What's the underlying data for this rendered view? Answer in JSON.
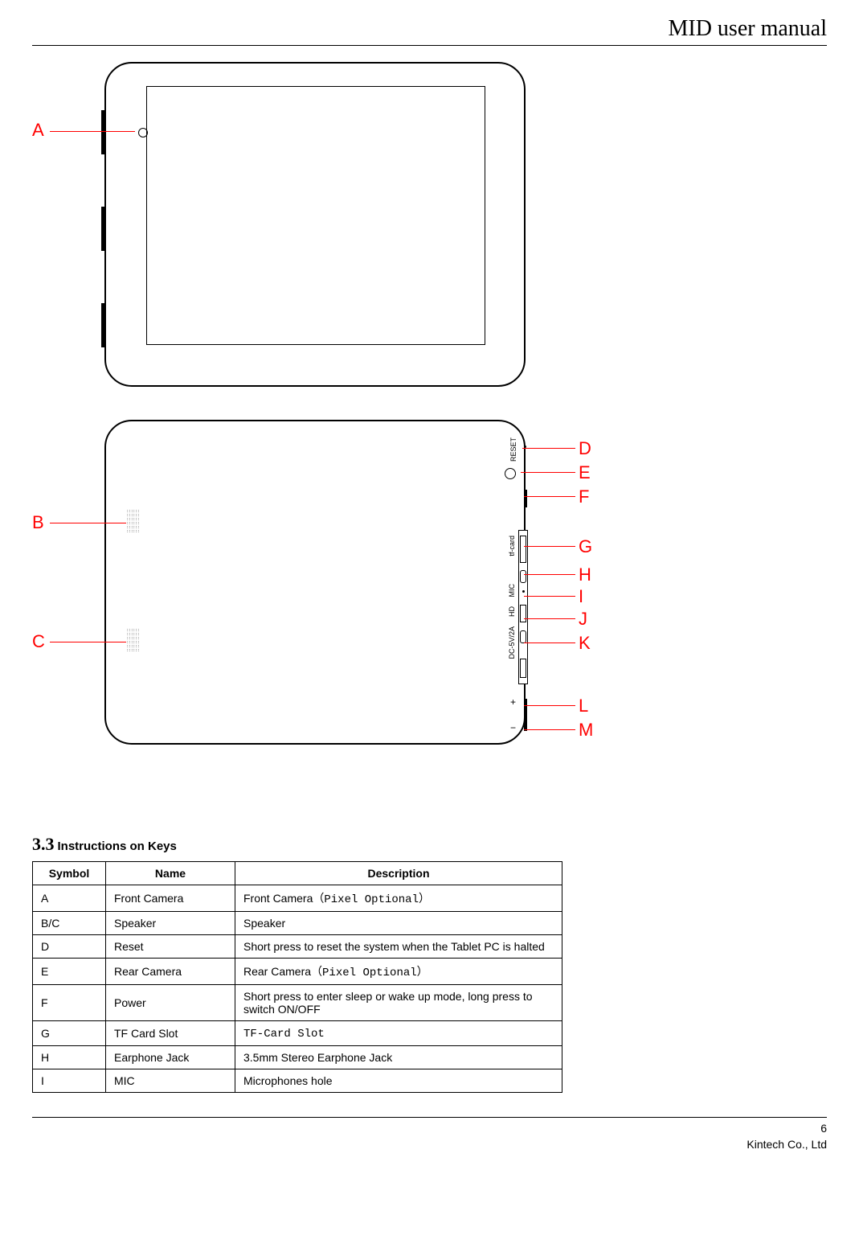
{
  "header": {
    "title": "MID user manual"
  },
  "diagram": {
    "labels": {
      "A": "A",
      "B": "B",
      "C": "C",
      "D": "D",
      "E": "E",
      "F": "F",
      "G": "G",
      "H": "H",
      "I": "I",
      "J": "J",
      "K": "K",
      "L": "L",
      "M": "M"
    },
    "port_text": {
      "reset": "RESET",
      "tfcard": "tf-card",
      "mic": "MIC",
      "hd": "HD",
      "dc": "DC-5V/2A"
    }
  },
  "section": {
    "number": "3.3",
    "title": "Instructions on Keys"
  },
  "table": {
    "headers": {
      "symbol": "Symbol",
      "name": "Name",
      "description": "Description"
    },
    "rows": [
      {
        "symbol": "A",
        "name": "Front Camera",
        "desc_prefix": "Front Camera",
        "desc_mono": "（Pixel Optional）"
      },
      {
        "symbol": "B/C",
        "name": "Speaker",
        "desc_prefix": "Speaker",
        "desc_mono": ""
      },
      {
        "symbol": "D",
        "name": "Reset",
        "desc_prefix": "Short press to reset the system when the Tablet PC is halted",
        "desc_mono": ""
      },
      {
        "symbol": "E",
        "name": "Rear Camera",
        "desc_prefix": "Rear Camera",
        "desc_mono": "（Pixel Optional）"
      },
      {
        "symbol": "F",
        "name": "Power",
        "desc_prefix": "Short press to enter sleep or wake up mode, long press to switch ON/OFF",
        "desc_mono": ""
      },
      {
        "symbol": "G",
        "name": "TF Card Slot",
        "desc_prefix": "",
        "desc_mono": "TF-Card Slot"
      },
      {
        "symbol": "H",
        "name": "Earphone Jack",
        "desc_prefix": "3.5mm Stereo Earphone Jack",
        "desc_mono": ""
      },
      {
        "symbol": "I",
        "name": "MIC",
        "desc_prefix": "Microphones hole",
        "desc_mono": ""
      }
    ]
  },
  "footer": {
    "page": "6",
    "company": "Kintech Co., Ltd"
  }
}
